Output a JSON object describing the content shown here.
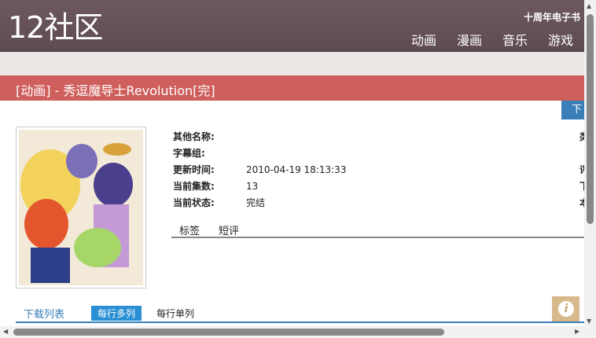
{
  "header": {
    "logo": "12社区",
    "ebook_link": "十周年电子书",
    "nav": [
      "动画",
      "漫画",
      "音乐",
      "游戏"
    ]
  },
  "title": "[动画] - 秀逗魔导士Revolution[完]",
  "download_button": "下",
  "info": {
    "rows": [
      {
        "label": "其他名称:",
        "value": ""
      },
      {
        "label": "字幕组:",
        "value": ""
      },
      {
        "label": "更新时间:",
        "value": "2010-04-19 18:13:33"
      },
      {
        "label": "当前集数:",
        "value": "13"
      },
      {
        "label": "当前状态:",
        "value": "完结"
      }
    ],
    "right_cut": [
      "类",
      "评",
      "下",
      "本"
    ]
  },
  "tabs": [
    "标签",
    "短评"
  ],
  "download_tabs": {
    "label": "下载列表",
    "multi": "每行多列",
    "single": "每行单列"
  },
  "info_icon": "info-icon",
  "colors": {
    "header": "#5e4b52",
    "title_bar": "#cf5f5c",
    "accent": "#2a8fd4"
  }
}
